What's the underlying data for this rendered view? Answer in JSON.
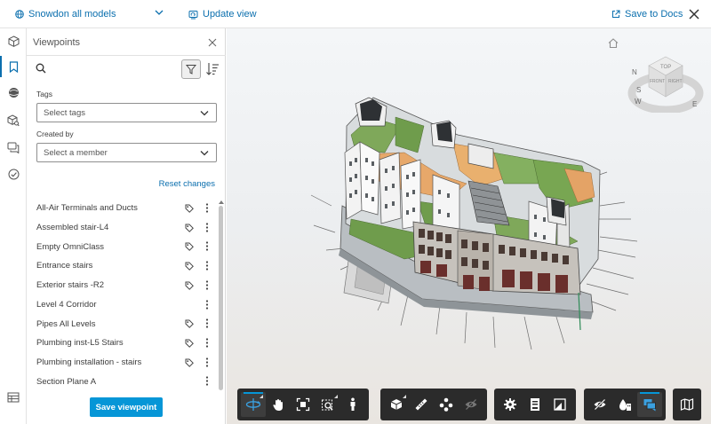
{
  "topbar": {
    "model_label": "Snowdon all models",
    "update_view_label": "Update view",
    "save_to_docs_label": "Save to Docs"
  },
  "panel": {
    "title": "Viewpoints",
    "tags_label": "Tags",
    "tags_placeholder": "Select tags",
    "created_by_label": "Created by",
    "member_placeholder": "Select a member",
    "reset_label": "Reset changes",
    "save_label": "Save viewpoint"
  },
  "viewpoints": [
    {
      "name": "All-Air Terminals and Ducts",
      "tagged": true
    },
    {
      "name": "Assembled stair-L4",
      "tagged": true
    },
    {
      "name": "Empty OmniClass",
      "tagged": true
    },
    {
      "name": "Entrance stairs",
      "tagged": true
    },
    {
      "name": "Exterior stairs -R2",
      "tagged": true
    },
    {
      "name": "Level 4 Corridor",
      "tagged": false
    },
    {
      "name": "Pipes All Levels",
      "tagged": true
    },
    {
      "name": "Plumbing inst-L5 Stairs",
      "tagged": true
    },
    {
      "name": "Plumbing installation - stairs",
      "tagged": true
    },
    {
      "name": "Section Plane A",
      "tagged": false
    }
  ],
  "viewcube": {
    "top": "TOP",
    "front": "FRONT",
    "right": "RIGHT",
    "north": "N",
    "south": "S",
    "east": "E",
    "west": "W"
  },
  "colors": {
    "accent": "#0696d7",
    "link": "#0b6fae",
    "toolbar": "#2b2b2b"
  }
}
